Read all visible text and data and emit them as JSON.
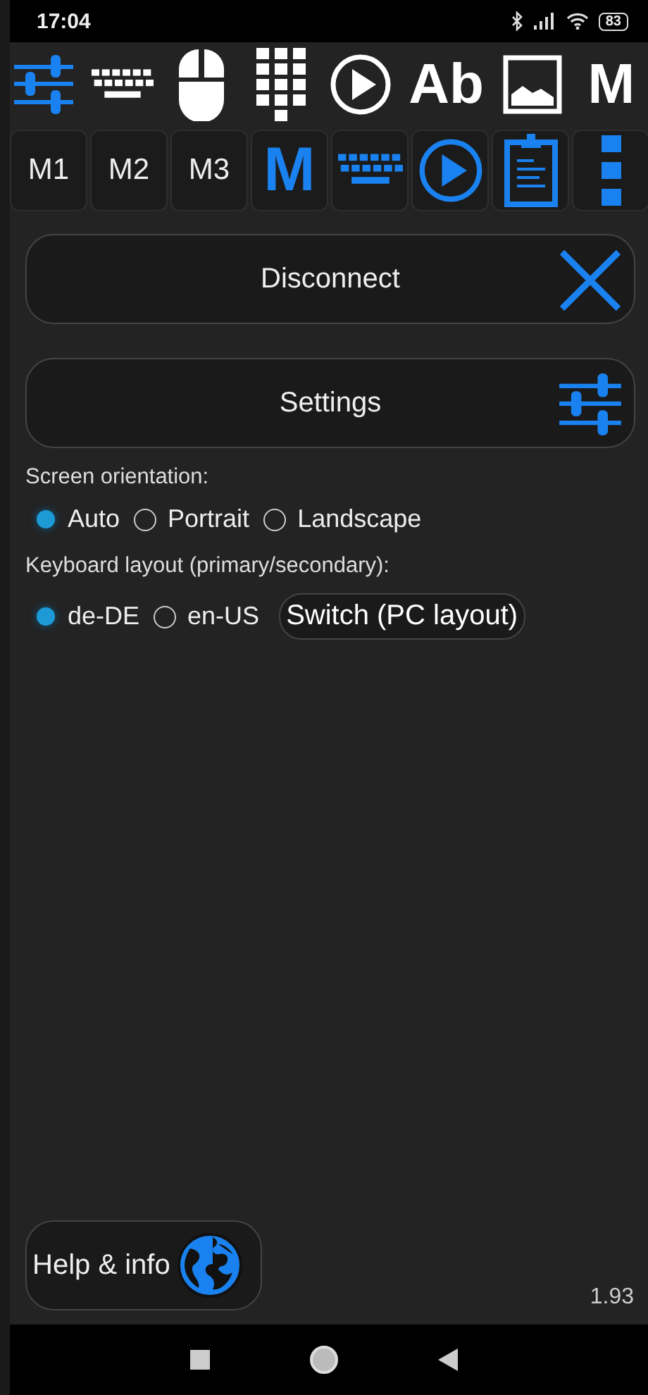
{
  "status_bar": {
    "time": "17:04",
    "battery": "83"
  },
  "toolbar": [
    {
      "kind": "sliders",
      "selected": true
    },
    {
      "kind": "keyboard",
      "selected": false
    },
    {
      "kind": "mouse",
      "selected": false
    },
    {
      "kind": "keypad",
      "selected": false
    },
    {
      "kind": "play",
      "selected": false
    },
    {
      "kind": "text",
      "label": "Ab",
      "selected": false
    },
    {
      "kind": "image",
      "selected": false
    },
    {
      "kind": "text",
      "label": "M",
      "selected": false
    }
  ],
  "shortcuts": [
    {
      "kind": "text",
      "label": "M1",
      "active": false
    },
    {
      "kind": "text",
      "label": "M2",
      "active": false
    },
    {
      "kind": "text",
      "label": "M3",
      "active": false
    },
    {
      "kind": "text",
      "label": "M",
      "active": true
    },
    {
      "kind": "keyboard",
      "active": true
    },
    {
      "kind": "play",
      "active": true
    },
    {
      "kind": "clipboard",
      "active": true
    },
    {
      "kind": "more",
      "active": true
    }
  ],
  "actions": [
    {
      "label": "Disconnect",
      "kind": "close"
    },
    {
      "label": "Settings",
      "kind": "sliders"
    }
  ],
  "screen_orientation": {
    "label": "Screen orientation:",
    "options": [
      {
        "label": "Auto",
        "selected": true
      },
      {
        "label": "Portrait",
        "selected": false
      },
      {
        "label": "Landscape",
        "selected": false
      }
    ]
  },
  "keyboard_layout": {
    "label": "Keyboard layout (primary/secondary):",
    "options": [
      {
        "label": "de-DE",
        "selected": true
      },
      {
        "label": "en-US",
        "selected": false
      }
    ],
    "switch_button": "Switch (PC layout)"
  },
  "help_button": "Help & info",
  "version": "1.93"
}
